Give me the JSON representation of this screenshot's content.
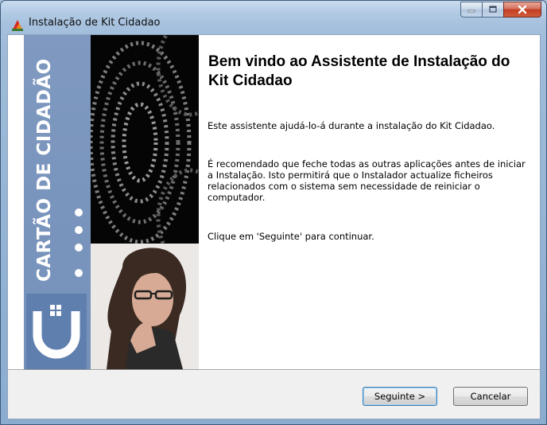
{
  "window": {
    "title": "Instalação de Kit Cidadao",
    "controls": {
      "minimize_icon": "minimize-icon",
      "maximize_icon": "maximize-icon",
      "close_icon": "close-icon"
    }
  },
  "sidebar": {
    "brand_text": "CARTÃO DE CIDADÃO",
    "logo_icon": "cartao-cidadao-logo",
    "colors": {
      "strip": "#7591ba",
      "text": "#ffffff"
    }
  },
  "content": {
    "heading": "Bem vindo ao Assistente de Instalação do Kit Cidadao",
    "paragraphs": [
      "Este assistente ajudá-lo-á durante a instalação do Kit Cidadao.",
      "É recomendado que feche todas as outras aplicações antes de iniciar a Instalação. Isto permitirá que o Instalador actualize ficheiros relacionados com o sistema sem necessidade de reiniciar o computador.",
      "Clique em 'Seguinte' para continuar."
    ]
  },
  "footer": {
    "next_label": "Seguinte >",
    "cancel_label": "Cancelar"
  }
}
